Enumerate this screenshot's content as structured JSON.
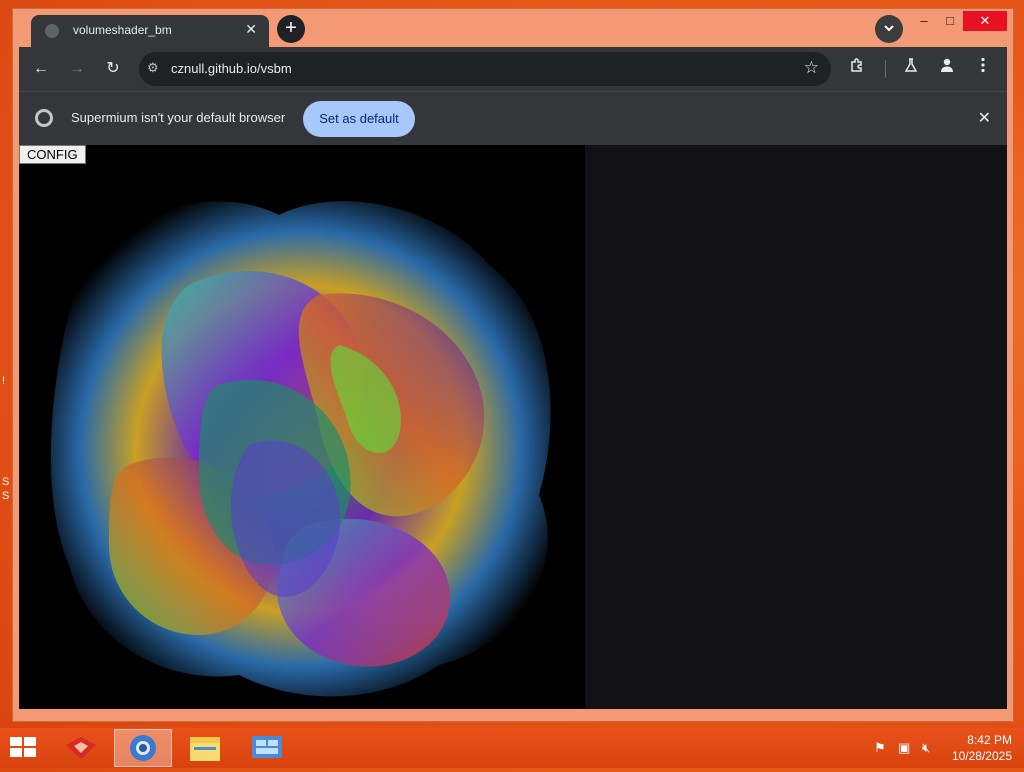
{
  "browser": {
    "tab_title": "volumeshader_bm",
    "url": "cznull.github.io/vsbm",
    "window_controls": {
      "minimize": "–",
      "maximize": "□",
      "close": "✕"
    },
    "new_tab_symbol": "+",
    "tab_close_symbol": "✕",
    "tab_search_symbol": "⌄",
    "nav": {
      "back": "←",
      "forward": "→",
      "reload": "↻"
    },
    "icons": {
      "site_info": "tune-icon",
      "bookmark": "star-icon",
      "extensions": "puzzle-icon",
      "labs": "flask-icon",
      "profile": "person-icon",
      "menu": "kebab-menu-icon"
    }
  },
  "infobar": {
    "message": "Supermium isn't your default browser",
    "button_label": "Set as default",
    "close_symbol": "✕"
  },
  "page": {
    "config_button": "CONFIG"
  },
  "taskbar": {
    "time": "8:42 PM",
    "date": "10/28/2025",
    "items": [
      "start",
      "app-red",
      "browser",
      "file-explorer",
      "control-panel"
    ]
  },
  "colors": {
    "accent_orange": "#e85a18",
    "infobar_button": "#a8c7fa",
    "toolbar_bg": "#35363a"
  }
}
